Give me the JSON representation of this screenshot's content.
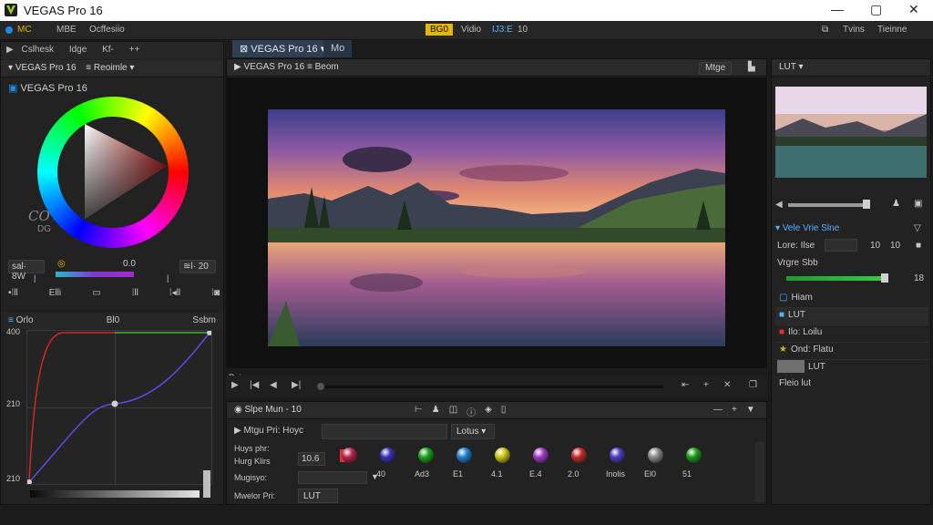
{
  "window": {
    "title": "VEGAS Pro 16",
    "min": "—",
    "max": "▢",
    "close": "✕"
  },
  "menubar": {
    "left": [
      "MC",
      "MBE",
      "Ocffesiio"
    ],
    "center": [
      "BG0",
      "Vidio",
      "IJ3:E",
      "10"
    ],
    "right": [
      "Tvins",
      "Tieinne"
    ]
  },
  "left": {
    "toolbar": [
      "Cslhesk",
      "Idge",
      "Kf-",
      "++"
    ],
    "header": {
      "title": "VEGAS Pro 16",
      "dropdown": "Reoimle"
    },
    "subtitle": "VEGAS Pro 16",
    "colorwheel": {
      "loop_label": "CO",
      "loop_sub": "DG",
      "value_label": "0.0",
      "left_btn": "sal· 8W",
      "right_btn": "≋l· 20",
      "row": [
        "•⁞ll",
        "Elli",
        "▭",
        "⁞ll",
        "⁞◂ll",
        "⁞◙"
      ]
    },
    "curves": {
      "header": [
        "Orlo",
        "Bl0",
        "Ssbm"
      ],
      "y_labels": [
        "400",
        "210",
        "210"
      ]
    }
  },
  "preview": {
    "tabs": [
      "VEGAS Pro 16",
      "Mo"
    ],
    "header": {
      "title": "VEGAS Pro 16",
      "dropdown": "Beom",
      "right_button": "Mtge"
    },
    "section_label": "Reieson"
  },
  "timeline": {
    "header": "Slpe Mun - 10",
    "rows": [
      {
        "label": "Mtgu Pri:",
        "value": "Hoyc",
        "dropdown": "Lotus"
      },
      {
        "label": "Huys phr:",
        "sub": "Hurg Klirs",
        "value": "10.6"
      },
      {
        "label": "Mugisyo:",
        "value": ""
      },
      {
        "label": "Mwelor Pri:",
        "value": "LUT"
      }
    ],
    "orb_values": [
      "40",
      "Ad3",
      "E1",
      "4.1",
      "E.4",
      "2.0",
      "Inolis",
      "El0",
      "51"
    ],
    "orb_colors": [
      "#b8244a",
      "#3a2fb8",
      "#19a319",
      "#1f7ed0",
      "#c7c313",
      "#a23ac8",
      "#c82828",
      "#4a3cc4",
      "#8a8a8a",
      "#1a9a1a"
    ]
  },
  "right": {
    "header": "LUT",
    "section1": {
      "title": "Vele",
      "sub": "Vrie Slne",
      "row1": "Lore: Ilse",
      "row1_val": "10",
      "row1_val2": "10"
    },
    "row_label": "Vrgre Sbb",
    "row_value": "18",
    "items": [
      {
        "label": "Hiam"
      },
      {
        "label": "LUT"
      },
      {
        "label": "Ilo: Loilu"
      },
      {
        "label": "Ond: Flatu"
      }
    ],
    "footer": {
      "title": "LUT",
      "sub": "Fleio  lut"
    }
  }
}
